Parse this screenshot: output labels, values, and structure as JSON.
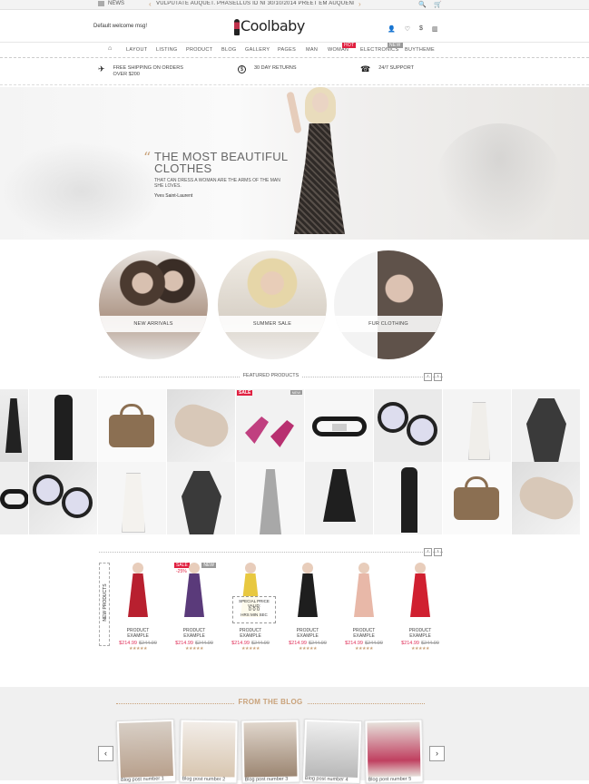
{
  "topbar": {
    "news_label": "NEWS",
    "ticker": "VULPUTATE AUQUET. PHASELLUS ID NI 30/10/2014 PREET EM AUQUENEC",
    "ticker_prev": "‹",
    "ticker_next": "›",
    "search_icon": "🔍",
    "cart_icon": "🛒"
  },
  "header": {
    "welcome": "Default welcome msg!",
    "logo": "Coolbaby",
    "icons": [
      "👤",
      "♡",
      "$",
      "▥"
    ]
  },
  "nav": {
    "home": "⌂",
    "items": [
      "LAYOUT",
      "LISTING",
      "PRODUCT",
      "BLOG",
      "GALLERY",
      "PAGES",
      "MAN",
      "WOMAN",
      "ELECTRONICS",
      "BUYTHEME"
    ],
    "badges": {
      "hot": "HOT",
      "new": "NEW"
    }
  },
  "features": [
    {
      "icon": "✈",
      "text": "FREE SHIPPING ON ORDERS OVER $200"
    },
    {
      "icon": "$",
      "text": "30  DAY RETURNS"
    },
    {
      "icon": "☎",
      "text": "24/7 SUPPORT"
    }
  ],
  "hero": {
    "quote_mark": "“",
    "line1": "THE MOST BEAUTIFUL",
    "line2": "CLOTHES",
    "sub": "THAT CAN DRESS A WOMAN ARE THE ARMS OF THE MAN SHE LOVES.",
    "author": "Yves Saint-Laurent"
  },
  "categories": [
    "NEW ARRIVALS",
    "SUMMER SALE",
    "FUR CLOTHING"
  ],
  "featured": {
    "title": "FEATURED PRODUCTS",
    "prev": "‹",
    "next": "›",
    "sale": "SALE",
    "new": "NEW"
  },
  "newproducts": {
    "label": "NEW PRODUCTS",
    "prev": "‹",
    "next": "›",
    "products": [
      {
        "name": "PRODUCT EXAMPLE",
        "price": "$214.99",
        "old": "$244.99",
        "stars": "★★★★★",
        "color": "#b8202f"
      },
      {
        "name": "PRODUCT EXAMPLE",
        "price": "$214.99",
        "old": "$244.99",
        "stars": "★★★★★",
        "color": "#5a3a7a"
      },
      {
        "name": "PRODUCT EXAMPLE",
        "price": "$214.99",
        "old": "$244.99",
        "stars": "★★★★★",
        "color": "#e8c840"
      },
      {
        "name": "PRODUCT EXAMPLE",
        "price": "$214.99",
        "old": "$244.99",
        "stars": "★★★★★",
        "color": "#1e1e1e"
      },
      {
        "name": "PRODUCT EXAMPLE",
        "price": "$214.99",
        "old": "$244.99",
        "stars": "★★★★★",
        "color": "#e8b8a8"
      },
      {
        "name": "PRODUCT EXAMPLE",
        "price": "$214.99",
        "old": "$244.99",
        "stars": "★★★★★",
        "color": "#d02030"
      }
    ],
    "sale": "SALE",
    "discount": "-25%",
    "new": "NEW",
    "special": "SPECIAL PRICE VALID:",
    "timer": "0  0  0",
    "timer_units": "HRS MIN SEC"
  },
  "blog": {
    "title": "FROM THE BLOG",
    "prev": "‹",
    "next": "›",
    "posts": [
      "Blog post number 1",
      "Blog post number 2",
      "Blog post number 3",
      "Blog post number 4",
      "Blog post number 5"
    ]
  },
  "colors": {
    "accent": "#c9a27a",
    "sale": "#e0305a",
    "hot": "#e02040"
  }
}
